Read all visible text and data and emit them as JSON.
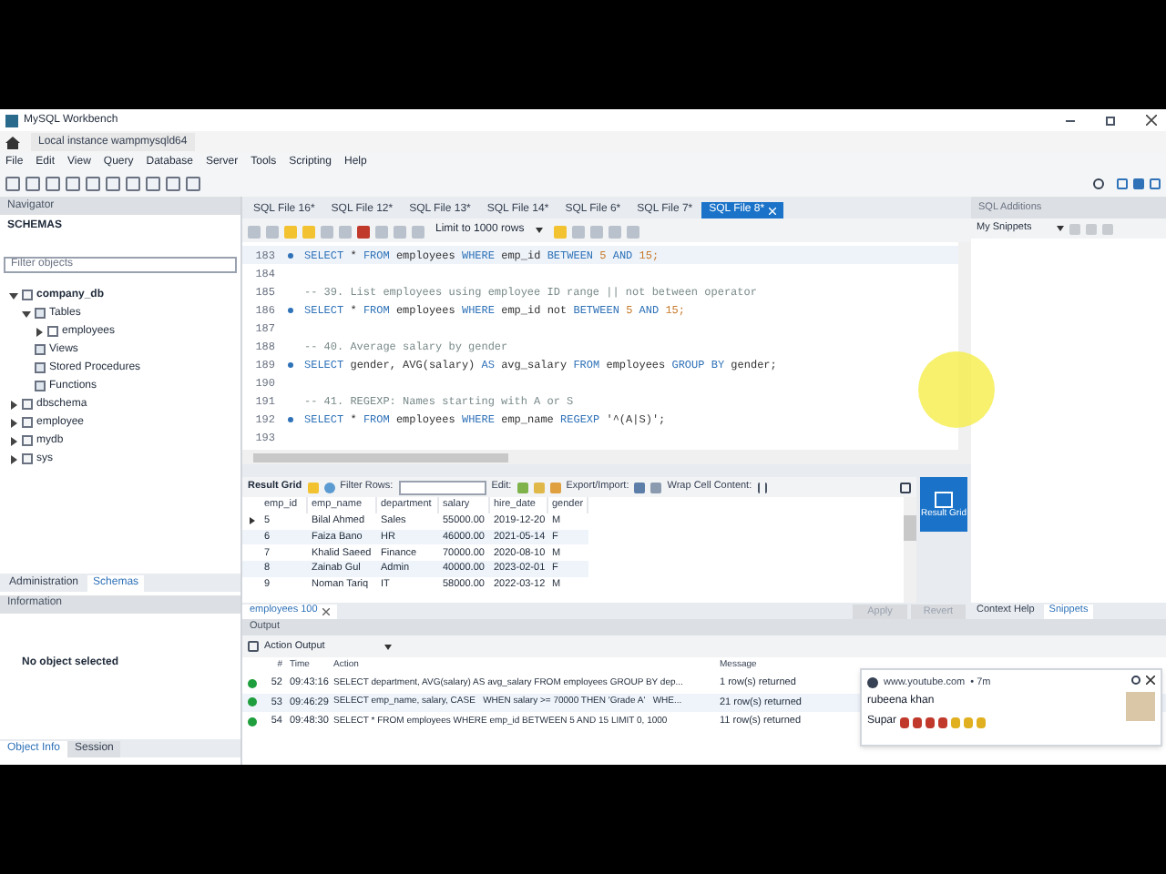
{
  "window": {
    "title": "MySQL Workbench",
    "connection_tab": "Local instance wampmysqld64"
  },
  "menu": [
    "File",
    "Edit",
    "View",
    "Query",
    "Database",
    "Server",
    "Tools",
    "Scripting",
    "Help"
  ],
  "navigator": {
    "title": "Navigator",
    "section": "SCHEMAS",
    "filter_placeholder": "Filter objects",
    "tree": [
      {
        "label": "company_db",
        "kind": "schema",
        "expanded": true,
        "children": [
          {
            "label": "Tables",
            "kind": "folder",
            "expanded": true,
            "children": [
              {
                "label": "employees",
                "kind": "table",
                "expanded": false
              }
            ]
          },
          {
            "label": "Views",
            "kind": "folder"
          },
          {
            "label": "Stored Procedures",
            "kind": "folder"
          },
          {
            "label": "Functions",
            "kind": "folder"
          }
        ]
      },
      {
        "label": "dbschema",
        "kind": "schema",
        "expanded": false
      },
      {
        "label": "employee",
        "kind": "schema",
        "expanded": false
      },
      {
        "label": "mydb",
        "kind": "schema",
        "expanded": false
      },
      {
        "label": "sys",
        "kind": "schema",
        "expanded": false
      }
    ]
  },
  "nav_tabs": [
    {
      "label": "Administration",
      "selected": false
    },
    {
      "label": "Schemas",
      "selected": true
    }
  ],
  "information": {
    "title": "Information",
    "message": "No object selected"
  },
  "info_tabs": [
    {
      "label": "Object Info",
      "selected": true
    },
    {
      "label": "Session",
      "selected": false
    }
  ],
  "editor_tabs": [
    {
      "label": "SQL File 16*",
      "selected": false
    },
    {
      "label": "SQL File 12*",
      "selected": false
    },
    {
      "label": "SQL File 13*",
      "selected": false
    },
    {
      "label": "SQL File 14*",
      "selected": false
    },
    {
      "label": "SQL File 6*",
      "selected": false
    },
    {
      "label": "SQL File 7*",
      "selected": false
    },
    {
      "label": "SQL File 8*",
      "selected": true
    }
  ],
  "limit": "Limit to 1000 rows",
  "code_lines": [
    {
      "number": "183",
      "kind": "statement",
      "text": "SELECT * FROM employees WHERE emp_id BETWEEN 5 AND 15;",
      "current": true
    },
    {
      "number": "184",
      "kind": "blank",
      "current": false
    },
    {
      "number": "185",
      "kind": "comment",
      "text": "-- 39. List employees using employee ID range || not between operator",
      "current": false
    },
    {
      "number": "186",
      "kind": "statement",
      "text": "SELECT * FROM employees WHERE emp_id not BETWEEN 5 AND 15;",
      "current": false
    },
    {
      "number": "187",
      "kind": "blank",
      "current": false
    },
    {
      "number": "188",
      "kind": "comment",
      "text": "-- 40. Average salary by gender",
      "current": false
    },
    {
      "number": "189",
      "kind": "statement",
      "text": "SELECT gender, AVG(salary) AS avg_salary FROM employees GROUP BY gender;",
      "current": false
    },
    {
      "number": "190",
      "kind": "blank",
      "current": false
    },
    {
      "number": "191",
      "kind": "comment",
      "text": "-- 41. REGEXP: Names starting with A or S",
      "current": false
    },
    {
      "number": "192",
      "kind": "statement",
      "text": "SELECT * FROM employees WHERE emp_name REGEXP '^(A|S)';",
      "current": false
    },
    {
      "number": "193",
      "kind": "blank",
      "current": false
    }
  ],
  "result": {
    "label": "Result Grid",
    "filter_label": "Filter Rows:",
    "edit_label": "Edit:",
    "export_label": "Export/Import:",
    "wrap_label": "Wrap Cell Content:",
    "columns": [
      "emp_id",
      "emp_name",
      "department",
      "salary",
      "hire_date",
      "gender"
    ],
    "rows": [
      {
        "cells": [
          "5",
          "Bilal Ahmed",
          "Sales",
          "55000.00",
          "2019-12-20",
          "M"
        ],
        "selected": true
      },
      {
        "cells": [
          "6",
          "Faiza Bano",
          "HR",
          "46000.00",
          "2021-05-14",
          "F"
        ],
        "selected": false
      },
      {
        "cells": [
          "7",
          "Khalid Saeed",
          "Finance",
          "70000.00",
          "2020-08-10",
          "M"
        ],
        "selected": false
      },
      {
        "cells": [
          "8",
          "Zainab Gul",
          "Admin",
          "40000.00",
          "2023-02-01",
          "F"
        ],
        "selected": false
      },
      {
        "cells": [
          "9",
          "Noman Tariq",
          "IT",
          "58000.00",
          "2022-03-12",
          "M"
        ],
        "selected": false
      }
    ],
    "tab": "employees 100",
    "side_button": "Result Grid",
    "apply": "Apply",
    "revert": "Revert"
  },
  "sql_additions": {
    "title": "SQL Additions",
    "dropdown": "My Snippets"
  },
  "right_tabs": [
    {
      "label": "Context Help",
      "selected": false
    },
    {
      "label": "Snippets",
      "selected": true
    }
  ],
  "output": {
    "title": "Output",
    "dropdown": "Action Output",
    "columns": [
      "#",
      "Time",
      "Action",
      "Message"
    ],
    "rows": [
      {
        "success": true,
        "number": "52",
        "time": "09:43:16",
        "action": "SELECT department, AVG(salary) AS avg_salary FROM employees GROUP BY dep...",
        "message": "1 row(s) returned"
      },
      {
        "success": true,
        "number": "53",
        "time": "09:46:29",
        "action": "SELECT emp_name, salary, CASE   WHEN salary >= 70000 THEN 'Grade A'   WHE...",
        "message": "21 row(s) returned"
      },
      {
        "success": true,
        "number": "54",
        "time": "09:48:30",
        "action": "SELECT * FROM employees WHERE emp_id BETWEEN 5 AND 15 LIMIT 0, 1000",
        "message": "11 row(s) returned"
      }
    ]
  },
  "notification": {
    "source": "www.youtube.com",
    "age": "• 7m",
    "name": "rubeena khan",
    "text": "Supar"
  }
}
